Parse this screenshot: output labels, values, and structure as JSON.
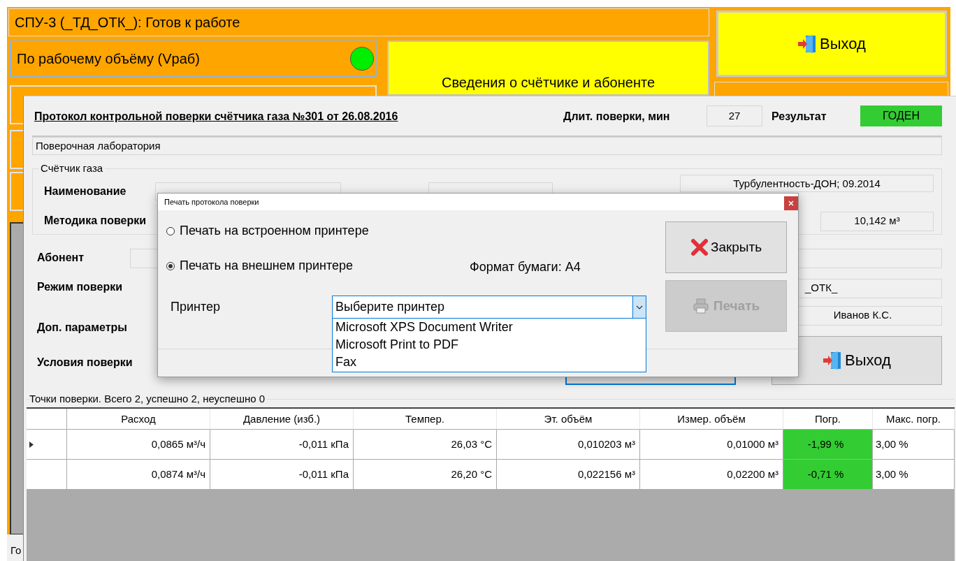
{
  "main_window": {
    "status_title": "СПУ-3 (_ТД_ОТК_): Готов к работе",
    "mode_button": {
      "label": "По рабочему объёму (Vраб)",
      "ready": true
    },
    "info_button": "Сведения о счётчике и абоненте",
    "exit_button": "Выход",
    "status_bar": "Го"
  },
  "protocol": {
    "title": "Протокол контрольной поверки счётчика газа №301 от 26.08.2016",
    "duration_label": "Длит. поверки, мин",
    "duration": "27",
    "result_label": "Результат",
    "result": "ГОДЕН",
    "result_ok": true,
    "lab": "Поверочная лаборатория",
    "meter_group": "Счётчик газа",
    "name_label": "Наименование",
    "method_label": "Методика поверки",
    "manufacturer": "Турбулентность-ДОН; 09.2014",
    "volume": "10,142 м³",
    "subscriber_label": "Абонент",
    "mode_label": "Режим поверки",
    "mode_value": "_ОТК_",
    "extra_label": "Доп. параметры",
    "operator": "Иванов К.С.",
    "conditions_label": "Условия поверки",
    "exit_button": "Выход",
    "points_caption": "Точки поверки. Всего 2, успешно 2, неуспешно 0",
    "table": {
      "columns": [
        "Расход",
        "Давление (изб.)",
        "Темпер.",
        "Эт. объём",
        "Измер. объём",
        "Погр.",
        "Макс. погр."
      ],
      "rows": [
        {
          "current": true,
          "passed": true,
          "cells": [
            "0,0865 м³/ч",
            "-0,011 кПа",
            "26,03 °C",
            "0,010203 м³",
            "0,01000 м³",
            "-1,99 %",
            "3,00 %"
          ]
        },
        {
          "current": false,
          "passed": true,
          "cells": [
            "0,0874 м³/ч",
            "-0,011 кПа",
            "26,20 °C",
            "0,022156 м³",
            "0,02200 м³",
            "-0,71 %",
            "3,00 %"
          ]
        }
      ]
    }
  },
  "print_dialog": {
    "title": "Печать протокола поверки",
    "options": [
      {
        "label": "Печать на встроенном принтере",
        "selected": false
      },
      {
        "label": "Печать на внешнем принтере",
        "selected": true
      }
    ],
    "paper_format": "Формат бумаги: A4",
    "printer_label": "Принтер",
    "printer_select": {
      "value": "Выберите принтер",
      "items": [
        "Microsoft XPS Document Writer",
        "Microsoft Print to PDF",
        "Fax"
      ]
    },
    "close_button": "Закрыть",
    "print_button": {
      "label": "Печать",
      "disabled": true
    }
  }
}
